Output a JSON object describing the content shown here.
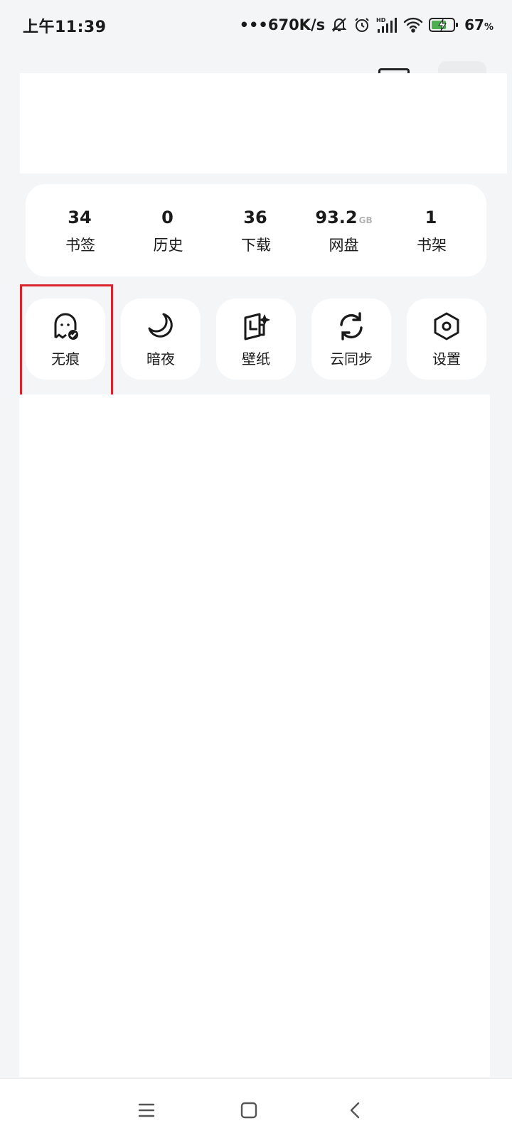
{
  "status_bar": {
    "time": "上午11:39",
    "network_speed": "•••670K/s",
    "battery_percent": "67",
    "battery_unit": "%",
    "icons": [
      "mute-bell-icon",
      "alarm-icon",
      "hd-signal-icon",
      "wifi-icon",
      "battery-charging-icon"
    ]
  },
  "stats": [
    {
      "value": "34",
      "unit": "",
      "label": "书签"
    },
    {
      "value": "0",
      "unit": "",
      "label": "历史"
    },
    {
      "value": "36",
      "unit": "",
      "label": "下载"
    },
    {
      "value": "93.2",
      "unit": "GB",
      "label": "网盘"
    },
    {
      "value": "1",
      "unit": "",
      "label": "书架"
    }
  ],
  "quick_actions": [
    {
      "label": "无痕",
      "icon": "ghost-incognito-icon"
    },
    {
      "label": "暗夜",
      "icon": "moon-icon"
    },
    {
      "label": "壁纸",
      "icon": "wallpaper-sparkle-icon"
    },
    {
      "label": "云同步",
      "icon": "sync-icon"
    },
    {
      "label": "设置",
      "icon": "gear-hexagon-icon"
    }
  ],
  "nav_bar": {
    "icons": [
      "menu-icon",
      "home-square-icon",
      "back-icon"
    ]
  },
  "colors": {
    "background": "#f4f5f7",
    "card": "#ffffff",
    "highlight": "#d9232d",
    "text": "#1a1a1a",
    "battery_fill": "#4caf50"
  }
}
